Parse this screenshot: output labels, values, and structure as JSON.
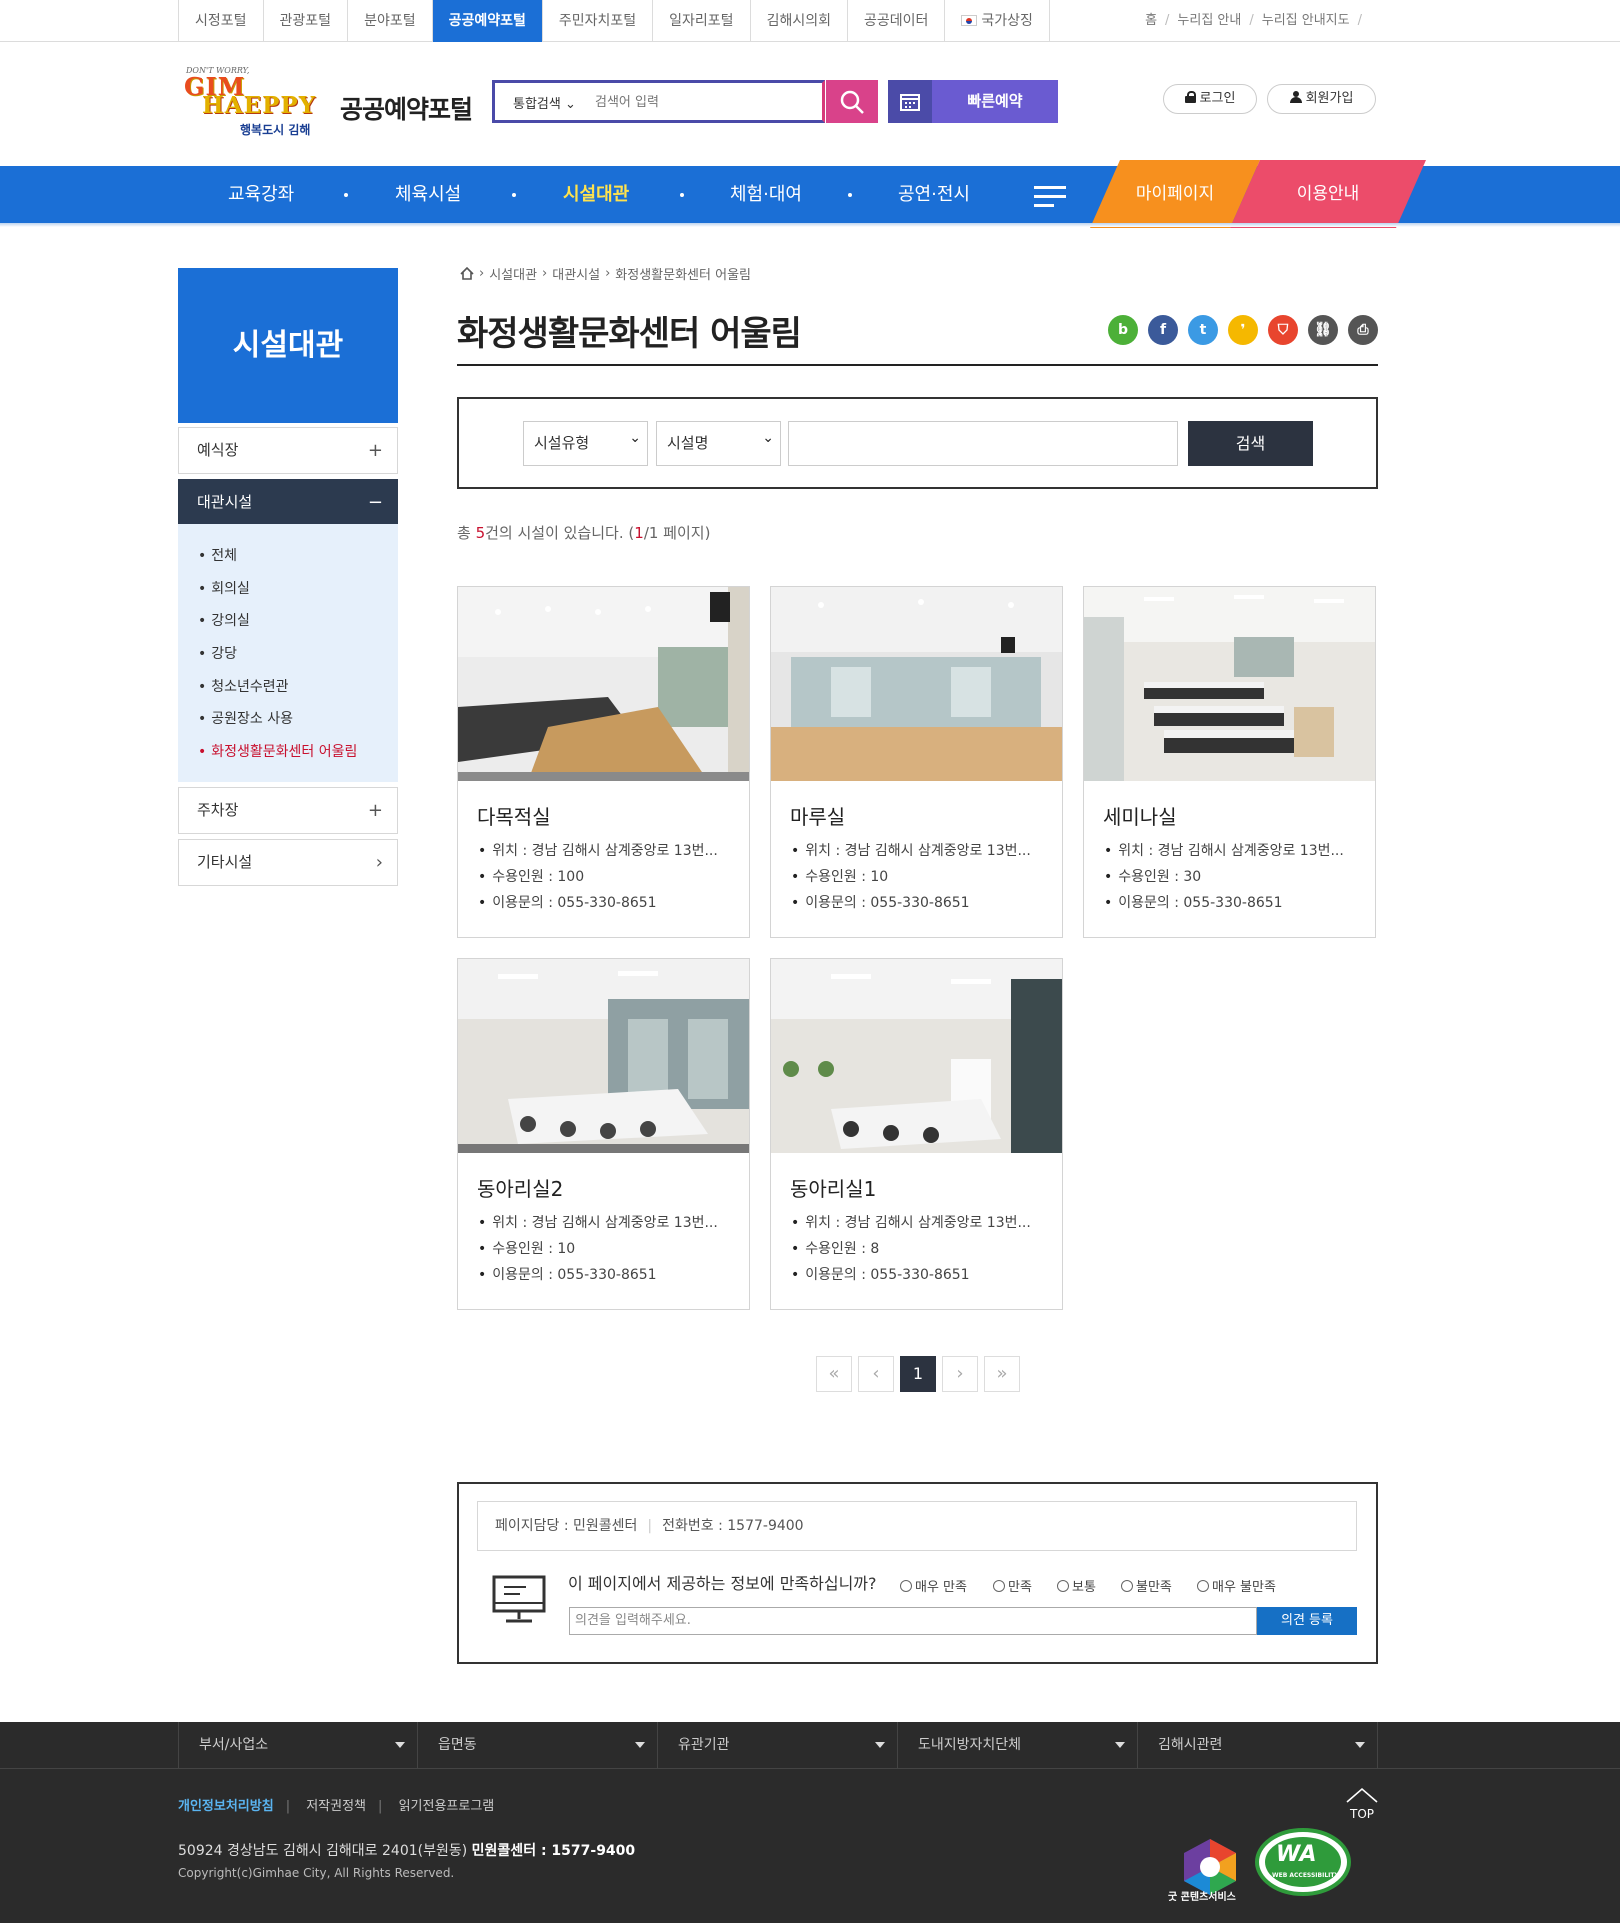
{
  "topbar": {
    "portal_tabs": [
      {
        "label": "시정포털"
      },
      {
        "label": "관광포털"
      },
      {
        "label": "분야포털"
      },
      {
        "label": "공공예약포털",
        "active": true
      },
      {
        "label": "주민자치포털"
      },
      {
        "label": "일자리포털"
      },
      {
        "label": "김해시의회"
      },
      {
        "label": "공공데이터"
      },
      {
        "label": "국가상징",
        "icon": "korea-flag-icon"
      }
    ],
    "util_links": [
      "홈",
      "누리집 안내",
      "누리집 안내지도"
    ]
  },
  "header": {
    "logo": {
      "top": "DON'T WORRY,",
      "line1": "GIM",
      "line2": "HAEPPY",
      "city": "행복도시 김해"
    },
    "site_name": "공공예약포털",
    "search": {
      "scope": "통합검색",
      "placeholder": "검색어 입력",
      "button_icon": "search-icon"
    },
    "quick_reserve": {
      "label": "빠른예약",
      "icon": "calendar-icon"
    },
    "login": "로그인",
    "join": "회원가입"
  },
  "gnb": {
    "items": [
      {
        "label": "교육강좌"
      },
      {
        "label": "체육시설"
      },
      {
        "label": "시설대관",
        "active": true
      },
      {
        "label": "체험·대여"
      },
      {
        "label": "공연·전시"
      }
    ],
    "all_menu_icon": "hamburger-icon",
    "mypage": "마이페이지",
    "guide": "이용안내"
  },
  "lnb": {
    "title": "시설대관",
    "items": [
      {
        "label": "예식장",
        "symbol": "+"
      },
      {
        "label": "대관시설",
        "symbol": "−",
        "open": true
      },
      {
        "label": "주차장",
        "symbol": "+"
      },
      {
        "label": "기타시설",
        "symbol": "›"
      }
    ],
    "sub_items": [
      "전체",
      "회의실",
      "강의실",
      "강당",
      "청소년수련관",
      "공원장소 사용",
      "화정생활문화센터 어울림"
    ],
    "current_sub": "화정생활문화센터 어울림"
  },
  "breadcrumb": {
    "home_icon": "home-icon",
    "items": [
      "시설대관",
      "대관시설",
      "화정생활문화센터 어울림"
    ]
  },
  "page_title": "화정생활문화센터 어울림",
  "share_icons": [
    {
      "name": "blog-icon",
      "glyph": "b",
      "color": "#4cb038"
    },
    {
      "name": "facebook-icon",
      "glyph": "f",
      "color": "#3b5a9a"
    },
    {
      "name": "twitter-icon",
      "glyph": "t",
      "color": "#3b9ae4"
    },
    {
      "name": "kakaostory-icon",
      "glyph": "❜",
      "color": "#f5b800"
    },
    {
      "name": "pdf-icon",
      "glyph": "⛉",
      "color": "#e8452e"
    },
    {
      "name": "link-icon",
      "glyph": "⛓",
      "color": "#555555"
    },
    {
      "name": "print-icon",
      "glyph": "⎙",
      "color": "#555555"
    }
  ],
  "search_panel": {
    "type_select": "시설유형",
    "name_select": "시설명",
    "keyword": "",
    "button": "검색"
  },
  "result": {
    "prefix": "총 ",
    "count": "5",
    "middle": "건의 시설이 있습니다. (",
    "page": "1",
    "suffix": "/1 페이지)"
  },
  "facilities": [
    {
      "name": "다목적실",
      "location": "위치 : 경남 김해시 삼계중앙로 13번...",
      "capacity": "수용인원 : 100",
      "contact": "이용문의 : 055-330-8651"
    },
    {
      "name": "마루실",
      "location": "위치 : 경남 김해시 삼계중앙로 13번...",
      "capacity": "수용인원 : 10",
      "contact": "이용문의 : 055-330-8651"
    },
    {
      "name": "세미나실",
      "location": "위치 : 경남 김해시 삼계중앙로 13번...",
      "capacity": "수용인원 : 30",
      "contact": "이용문의 : 055-330-8651"
    },
    {
      "name": "동아리실2",
      "location": "위치 : 경남 김해시 삼계중앙로 13번...",
      "capacity": "수용인원 : 10",
      "contact": "이용문의 : 055-330-8651"
    },
    {
      "name": "동아리실1",
      "location": "위치 : 경남 김해시 삼계중앙로 13번...",
      "capacity": "수용인원 : 8",
      "contact": "이용문의 : 055-330-8651"
    }
  ],
  "pagination": {
    "first": "«",
    "prev": "‹",
    "current": "1",
    "next": "›",
    "last": "»"
  },
  "feedback": {
    "manager": "페이지담당 : 민원콜센터",
    "phone": "전화번호 :  1577-9400",
    "question": "이 페이지에서 제공하는 정보에 만족하십니까?",
    "options": [
      "매우 만족",
      "만족",
      "보통",
      "불만족",
      "매우 불만족"
    ],
    "placeholder": "의견을 입력해주세요.",
    "submit": "의견 등록"
  },
  "footer": {
    "selects": [
      "부서/사업소",
      "읍면동",
      "유관기관",
      "도내지방자치단체",
      "김해시관련"
    ],
    "links": [
      "개인정보처리방침",
      "저작권정책",
      "읽기전용프로그램"
    ],
    "address": "50924 경상남도 김해시 김해대로 2401(부원동)",
    "callcenter": "민원콜센터 : 1577-9400",
    "copyright": "Copyright(c)Gimhae City, All Rights Reserved.",
    "top": "TOP",
    "gc_label": "굿 콘텐츠서비스",
    "wa_label": "WA",
    "wa_sub": "WEB ACCESSIBILITY"
  }
}
